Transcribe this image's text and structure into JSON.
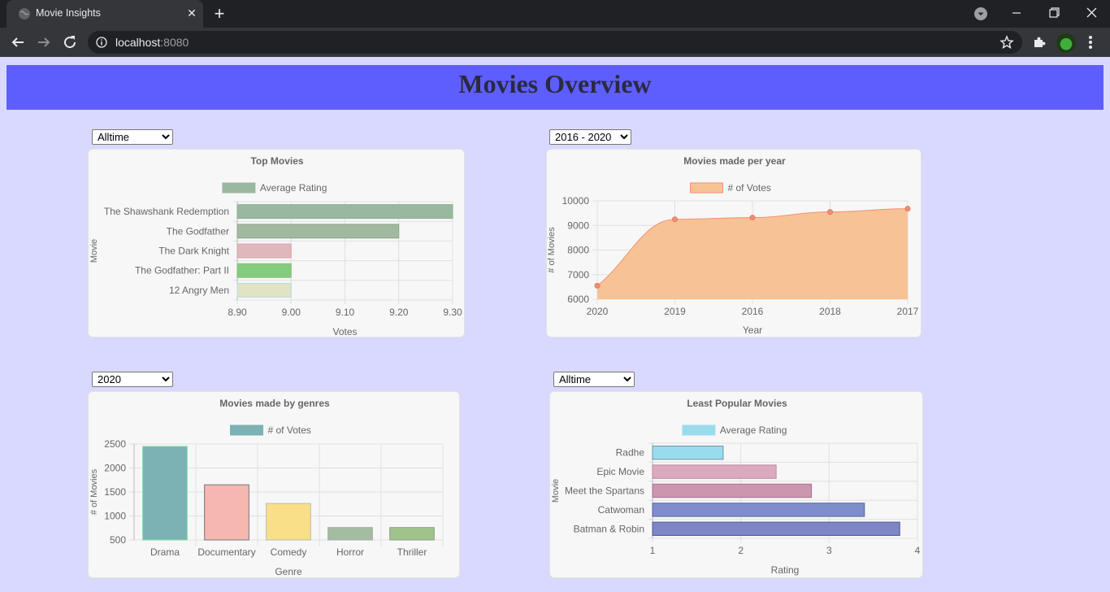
{
  "browser": {
    "tab_title": "Movie Insights",
    "url_host": "localhost",
    "url_port": ":8080"
  },
  "page": {
    "title": "Movies Overview"
  },
  "selects": {
    "top_movies": {
      "value": "Alltime",
      "options": [
        "Alltime"
      ]
    },
    "per_year": {
      "value": "2016 - 2020",
      "options": [
        "2016 - 2020"
      ]
    },
    "genres": {
      "value": "2020",
      "options": [
        "2020"
      ]
    },
    "least": {
      "value": "Alltime",
      "options": [
        "Alltime"
      ]
    }
  },
  "chart_data": [
    {
      "id": "top",
      "type": "bar",
      "orientation": "horizontal",
      "title": "Top Movies",
      "legend": "Average Rating",
      "legend_color": "#98b8a0",
      "xlabel": "Votes",
      "ylabel": "Movie",
      "categories": [
        "The Shawshank Redemption",
        "The Godfather",
        "The Dark Knight",
        "The Godfather: Part II",
        "12 Angry Men"
      ],
      "values": [
        9.3,
        9.2,
        9.0,
        9.0,
        9.0
      ],
      "colors": [
        "#98b8a0",
        "#a3b8a0",
        "#deb8bd",
        "#85cc7f",
        "#e1e3c6"
      ],
      "borders": [
        "#8fb08f",
        "#8aa88a",
        "#dba2aa",
        "#7fc079",
        "#b8dbe0"
      ],
      "xlim": [
        8.9,
        9.3
      ],
      "xticks": [
        "8.90",
        "9.00",
        "9.10",
        "9.20",
        "9.30"
      ]
    },
    {
      "id": "year",
      "type": "area",
      "title": "Movies made per year",
      "legend": "# of Votes",
      "legend_color": "#f8c394",
      "xlabel": "Year",
      "ylabel": "# of Movies",
      "categories": [
        "2020",
        "2019",
        "2016",
        "2018",
        "2017"
      ],
      "values": [
        6550,
        9250,
        9320,
        9550,
        9680
      ],
      "ylim": [
        6000,
        10000
      ],
      "yticks": [
        "10000",
        "9000",
        "8000",
        "7000",
        "6000"
      ],
      "color": "#f8c394",
      "line_color": "#f08f78"
    },
    {
      "id": "genre",
      "type": "bar",
      "title": "Movies made by genres",
      "legend": "# of Votes",
      "legend_color": "#7cb2b4",
      "xlabel": "Genre",
      "ylabel": "# of Movies",
      "categories": [
        "Drama",
        "Documentary",
        "Comedy",
        "Horror",
        "Thriller"
      ],
      "values": [
        2450,
        1650,
        1260,
        760,
        760
      ],
      "colors": [
        "#7cb2b4",
        "#f5b8b0",
        "#f8df88",
        "#a4bca1",
        "#9ec48a"
      ],
      "borders": [
        "#79e09a",
        "#777",
        "#bbb",
        "#aaa",
        "#999"
      ],
      "ylim": [
        500,
        2500
      ],
      "yticks": [
        "2500",
        "2000",
        "1500",
        "1000",
        "500"
      ]
    },
    {
      "id": "least",
      "type": "bar",
      "orientation": "horizontal",
      "title": "Least Popular Movies",
      "legend": "Average Rating",
      "legend_color": "#9adcee",
      "xlabel": "Rating",
      "ylabel": "Movie",
      "categories": [
        "Radhe",
        "Epic Movie",
        "Meet the Spartans",
        "Catwoman",
        "Batman & Robin"
      ],
      "values": [
        1.8,
        2.4,
        2.8,
        3.4,
        3.8
      ],
      "colors": [
        "#9adcee",
        "#dcaabf",
        "#cc96b0",
        "#7f8dcc",
        "#7f86c4"
      ],
      "borders": [
        "#6699aa",
        "#b888a0",
        "#a8708e",
        "#5565a8",
        "#5058a0"
      ],
      "xlim": [
        1,
        4
      ],
      "xticks": [
        "1",
        "2",
        "3",
        "4"
      ]
    }
  ]
}
